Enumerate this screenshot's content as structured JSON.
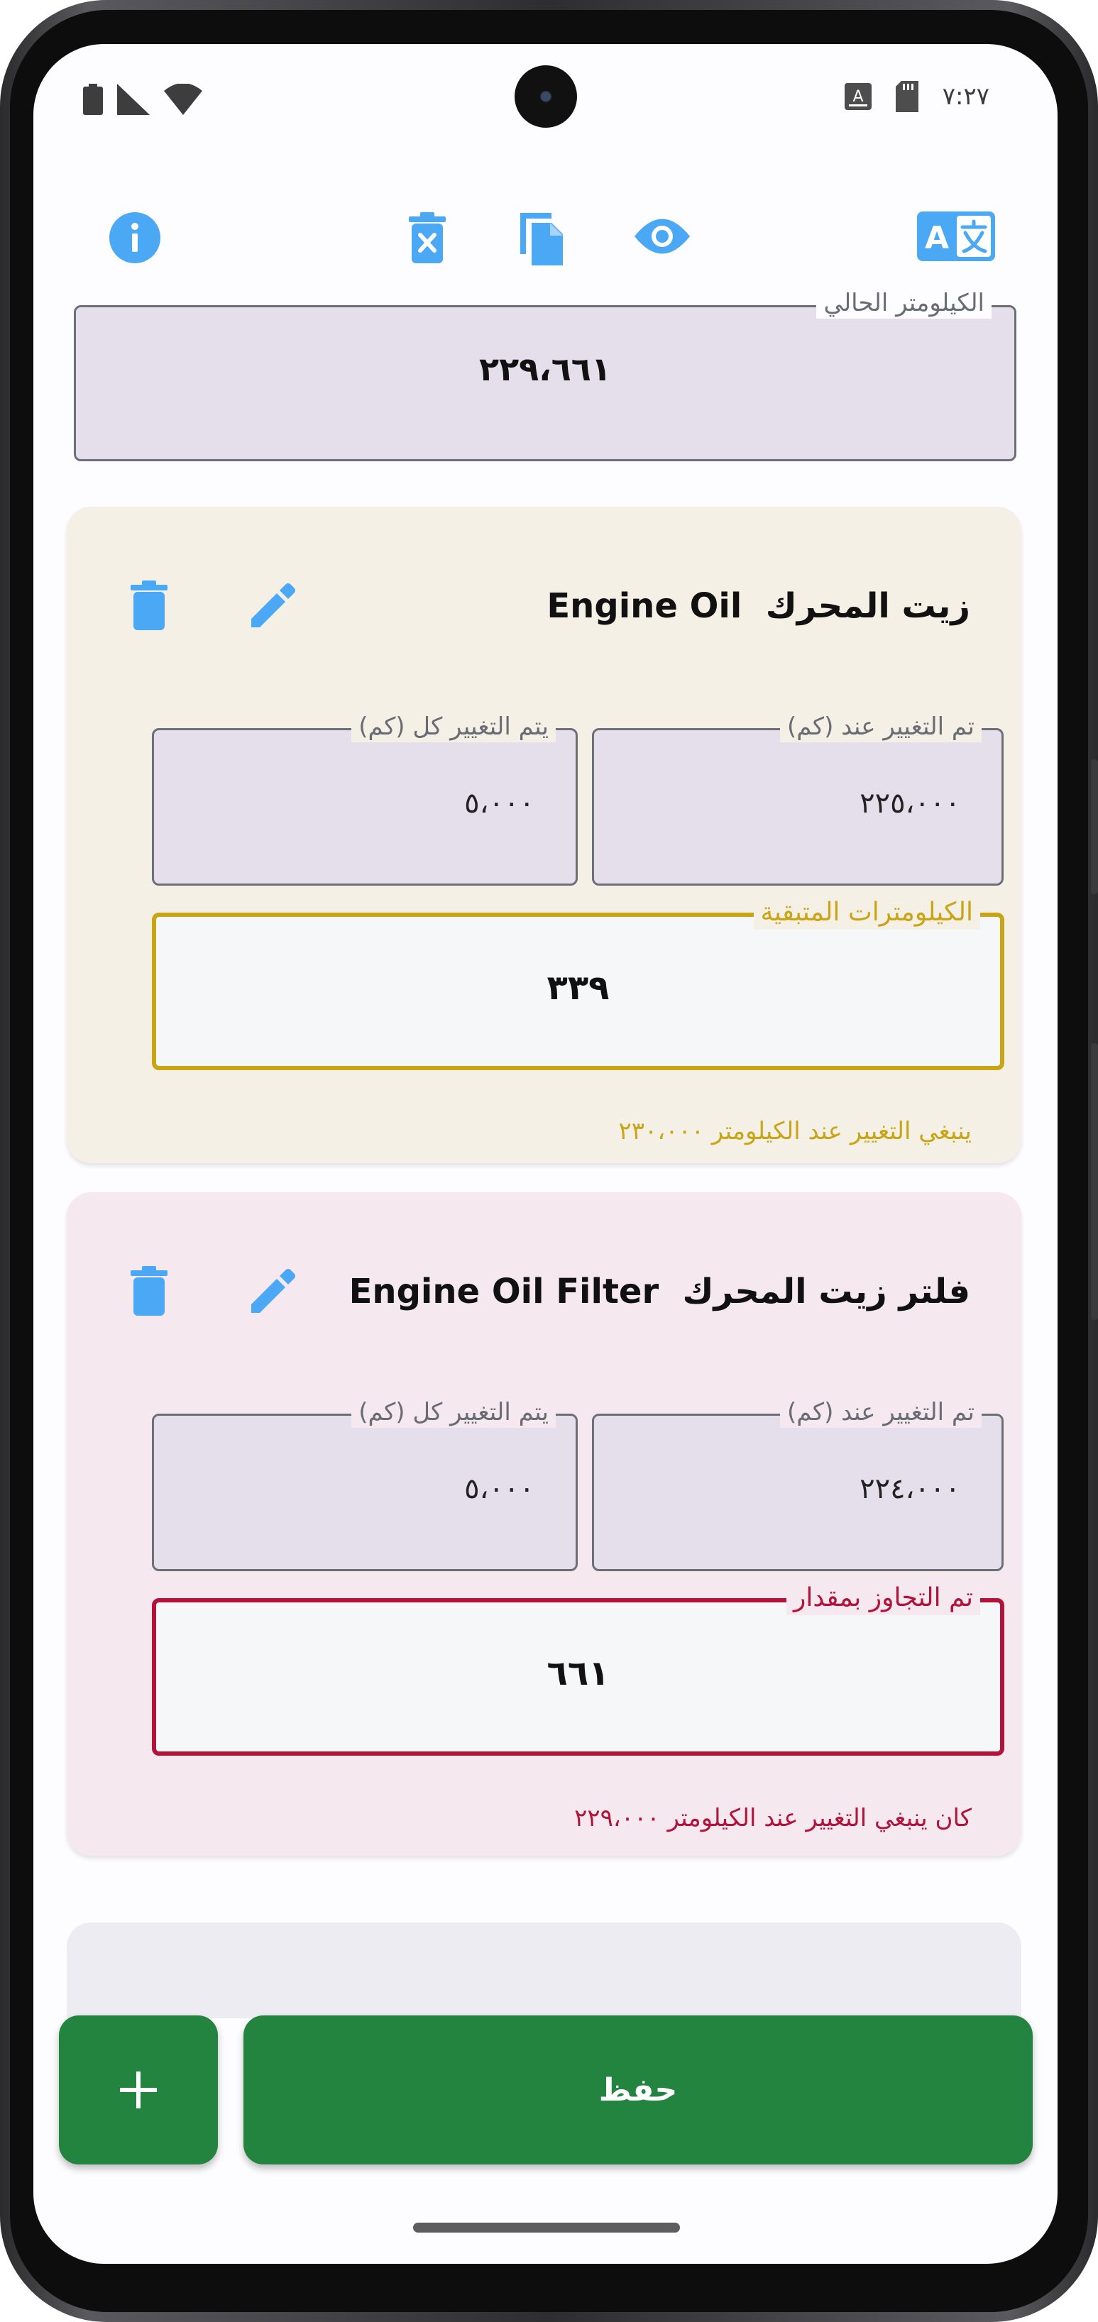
{
  "status_bar": {
    "time": "٧:٢٧"
  },
  "toolbar": {
    "icons": [
      "info-icon",
      "delete-all-icon",
      "copy-icon",
      "preview-icon",
      "translate-icon"
    ]
  },
  "current_km": {
    "label": "الكيلومتر الحالي",
    "value": "٢٢٩،٦٦١"
  },
  "items": [
    {
      "title_en": "Engine Oil",
      "title_ar": "زيت المحرك",
      "changed_at_label": "تم التغيير عند (كم)",
      "changed_at_value": "٢٢٥،٠٠٠",
      "interval_label": "يتم التغيير كل (كم)",
      "interval_value": "٥،٠٠٠",
      "status_label": "الكيلومترات المتبقية",
      "status_value": "٣٣٩",
      "helper": "ينبغي التغيير عند الكيلومتر ٢٣٠،٠٠٠",
      "status_color": "#c9a415",
      "background": "#f5f0e6"
    },
    {
      "title_en": "Engine Oil Filter",
      "title_ar": "فلتر زيت المحرك",
      "changed_at_label": "تم التغيير عند (كم)",
      "changed_at_value": "٢٢٤،٠٠٠",
      "interval_label": "يتم التغيير كل (كم)",
      "interval_value": "٥،٠٠٠",
      "status_label": "تم التجاوز بمقدار",
      "status_value": "٦٦١",
      "helper": "كان ينبغي التغيير عند الكيلومتر ٢٢٩،٠٠٠",
      "status_color": "#b3123a",
      "background": "#f5e9ef"
    }
  ],
  "buttons": {
    "save": "حفظ",
    "add": "+"
  },
  "colors": {
    "accent_blue": "#4aa8f5",
    "primary_green": "#22843f",
    "field_fill": "#e5dfeb",
    "third_card": "#edecf2"
  }
}
